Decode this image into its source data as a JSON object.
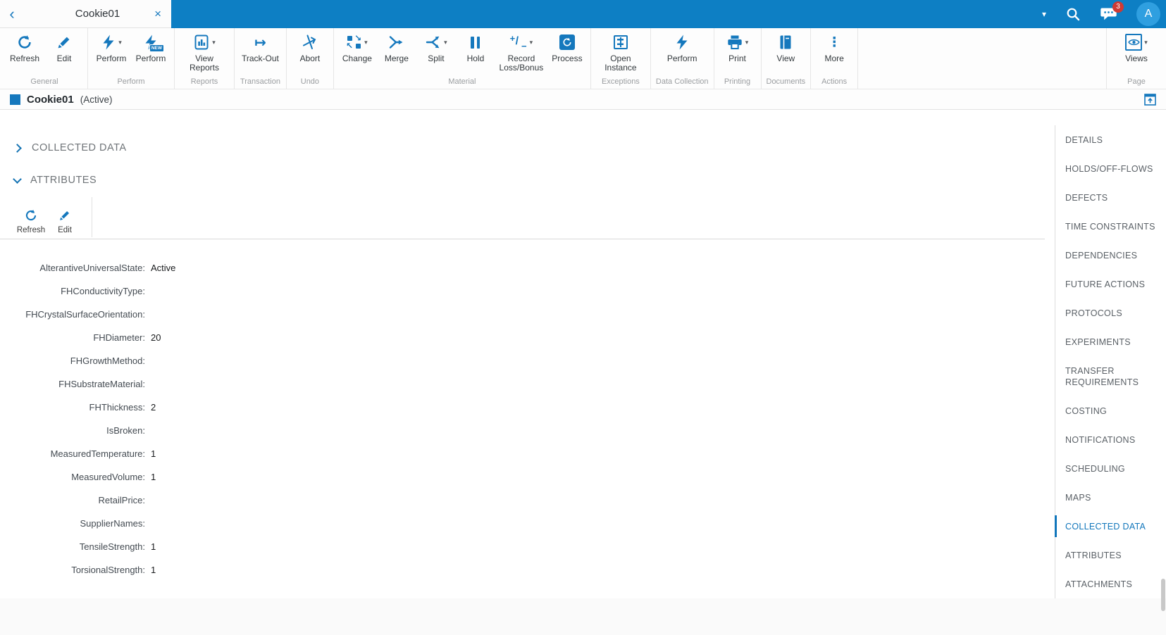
{
  "colors": {
    "topbar": "#0d7fc4",
    "accent": "#1578bd",
    "badge_red": "#ce3a34",
    "avatar_blue": "#2f9fe0",
    "active_nav": "#1176bb"
  },
  "icons": {
    "back-icon": "‹",
    "close-icon": "×",
    "caret-down-icon": "▾",
    "refresh-icon": "refresh",
    "edit-icon": "pencil",
    "perform-icon": "lightning-bolt",
    "view-reports-icon": "bar-chart",
    "track-out-icon": "↦",
    "abort-icon": "arrow-slash",
    "change-icon": "swap-squares",
    "merge-icon": "merge-arrows",
    "split-icon": "split-arrows",
    "hold-icon": "pause-bars",
    "record-loss-bonus-icon": "plus-minus",
    "process-icon": "refresh-square",
    "open-instance-icon": "binder-square",
    "print-icon": "printer",
    "view-documents-icon": "book",
    "more-icon": "⋮",
    "views-icon": "eye-box",
    "search-icon": "magnifier",
    "messages-icon": "chat-bubble",
    "collapse-icon": "window-up-arrow",
    "change-arrow-se": "↘",
    "change-arrow-nw": "↖",
    "record-plus": "+",
    "record-slash": "/",
    "record-minus": "−"
  },
  "topbar": {
    "tab_title": "Cookie01",
    "messages_badge": "3",
    "avatar_initial": "A"
  },
  "ribbon": {
    "groups": [
      {
        "label": "General",
        "buttons": [
          {
            "label": "Refresh",
            "icon": "refresh-icon"
          },
          {
            "label": "Edit",
            "icon": "edit-icon"
          }
        ]
      },
      {
        "label": "Perform",
        "buttons": [
          {
            "label": "Perform",
            "icon": "perform-icon",
            "caret": true
          },
          {
            "label": "Perform",
            "icon": "perform-icon",
            "badge": "NEW"
          }
        ]
      },
      {
        "label": "Reports",
        "buttons": [
          {
            "label": "View Reports",
            "icon": "view-reports-icon",
            "caret": true
          }
        ]
      },
      {
        "label": "Transaction",
        "buttons": [
          {
            "label": "Track-Out",
            "icon": "track-out-icon"
          }
        ]
      },
      {
        "label": "Undo",
        "buttons": [
          {
            "label": "Abort",
            "icon": "abort-icon"
          }
        ]
      },
      {
        "label": "Material",
        "buttons": [
          {
            "label": "Change",
            "icon": "change-icon",
            "caret": true
          },
          {
            "label": "Merge",
            "icon": "merge-icon"
          },
          {
            "label": "Split",
            "icon": "split-icon",
            "caret": true
          },
          {
            "label": "Hold",
            "icon": "hold-icon"
          },
          {
            "label": "Record Loss/Bonus",
            "icon": "record-loss-bonus-icon",
            "caret": true
          },
          {
            "label": "Process",
            "icon": "process-icon"
          }
        ]
      },
      {
        "label": "Exceptions",
        "buttons": [
          {
            "label": "Open Instance",
            "icon": "open-instance-icon"
          }
        ]
      },
      {
        "label": "Data Collection",
        "buttons": [
          {
            "label": "Perform",
            "icon": "perform-icon"
          }
        ]
      },
      {
        "label": "Printing",
        "buttons": [
          {
            "label": "Print",
            "icon": "print-icon",
            "caret": true
          }
        ]
      },
      {
        "label": "Documents",
        "buttons": [
          {
            "label": "View",
            "icon": "view-documents-icon"
          }
        ]
      },
      {
        "label": "Actions",
        "buttons": [
          {
            "label": "More",
            "icon": "more-icon"
          }
        ]
      },
      {
        "label": "Page",
        "align": "right",
        "buttons": [
          {
            "label": "Views",
            "icon": "views-icon",
            "caret": true
          }
        ]
      }
    ]
  },
  "titlebar": {
    "title": "Cookie01",
    "status": "(Active)"
  },
  "content": {
    "sections": {
      "collected_data": {
        "label": "COLLECTED DATA",
        "collapsed": true
      },
      "attributes": {
        "label": "ATTRIBUTES",
        "collapsed": false
      }
    },
    "attributes_toolbar": [
      {
        "label": "Refresh",
        "icon": "refresh-icon"
      },
      {
        "label": "Edit",
        "icon": "edit-icon"
      }
    ],
    "attributes": [
      {
        "name": "AlterantiveUniversalState:",
        "value": "Active"
      },
      {
        "name": "FHConductivityType:",
        "value": ""
      },
      {
        "name": "FHCrystalSurfaceOrientation:",
        "value": ""
      },
      {
        "name": "FHDiameter:",
        "value": "20"
      },
      {
        "name": "FHGrowthMethod:",
        "value": ""
      },
      {
        "name": "FHSubstrateMaterial:",
        "value": ""
      },
      {
        "name": "FHThickness:",
        "value": "2"
      },
      {
        "name": "IsBroken:",
        "value": ""
      },
      {
        "name": "MeasuredTemperature:",
        "value": "1"
      },
      {
        "name": "MeasuredVolume:",
        "value": "1"
      },
      {
        "name": "RetailPrice:",
        "value": ""
      },
      {
        "name": "SupplierNames:",
        "value": ""
      },
      {
        "name": "TensileStrength:",
        "value": "1"
      },
      {
        "name": "TorsionalStrength:",
        "value": "1"
      }
    ]
  },
  "sidenav": {
    "items": [
      {
        "label": "DETAILS"
      },
      {
        "label": "HOLDS/OFF-FLOWS"
      },
      {
        "label": "DEFECTS"
      },
      {
        "label": "TIME CONSTRAINTS"
      },
      {
        "label": "DEPENDENCIES"
      },
      {
        "label": "FUTURE ACTIONS"
      },
      {
        "label": "PROTOCOLS"
      },
      {
        "label": "EXPERIMENTS"
      },
      {
        "label": "TRANSFER REQUIREMENTS"
      },
      {
        "label": "COSTING"
      },
      {
        "label": "NOTIFICATIONS"
      },
      {
        "label": "SCHEDULING"
      },
      {
        "label": "MAPS"
      },
      {
        "label": "COLLECTED DATA",
        "active": true
      },
      {
        "label": "ATTRIBUTES"
      },
      {
        "label": "ATTACHMENTS"
      }
    ]
  }
}
